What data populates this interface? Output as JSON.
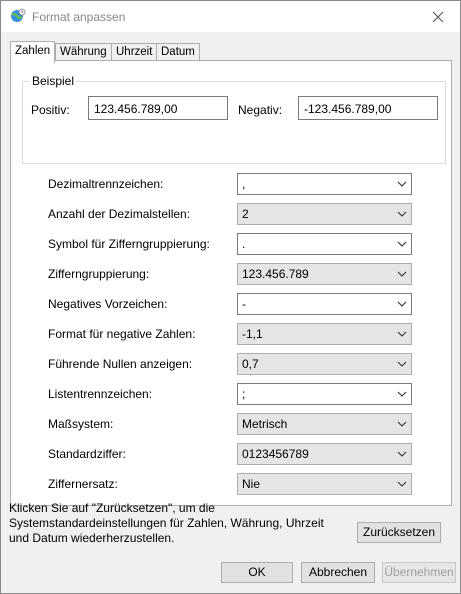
{
  "window": {
    "title": "Format anpassen"
  },
  "tabs": [
    {
      "label": "Zahlen",
      "active": true
    },
    {
      "label": "Währung",
      "active": false
    },
    {
      "label": "Uhrzeit",
      "active": false
    },
    {
      "label": "Datum",
      "active": false
    }
  ],
  "sample": {
    "group_title": "Beispiel",
    "positive_label": "Positiv:",
    "positive_value": "123.456.789,00",
    "negative_label": "Negativ:",
    "negative_value": "-123.456.789,00"
  },
  "settings": [
    {
      "label": "Dezimaltrennzeichen:",
      "value": ",",
      "readonly": false
    },
    {
      "label": "Anzahl der Dezimalstellen:",
      "value": "2",
      "readonly": true
    },
    {
      "label": "Symbol für Zifferngruppierung:",
      "value": ".",
      "readonly": false
    },
    {
      "label": "Zifferngruppierung:",
      "value": "123.456.789",
      "readonly": true
    },
    {
      "label": "Negatives Vorzeichen:",
      "value": "-",
      "readonly": false
    },
    {
      "label": "Format für negative Zahlen:",
      "value": "-1,1",
      "readonly": true
    },
    {
      "label": "Führende Nullen anzeigen:",
      "value": "0,7",
      "readonly": true
    },
    {
      "label": "Listentrennzeichen:",
      "value": ";",
      "readonly": false
    },
    {
      "label": "Maßsystem:",
      "value": "Metrisch",
      "readonly": true
    },
    {
      "label": "Standardziffer:",
      "value": "0123456789",
      "readonly": true
    },
    {
      "label": "Ziffernersatz:",
      "value": "Nie",
      "readonly": true
    }
  ],
  "info_text": "Klicken Sie auf \"Zurücksetzen\", um die Systemstandardeinstellungen für Zahlen, Währung, Uhrzeit und Datum wiederherzustellen.",
  "buttons": {
    "reset": "Zurücksetzen",
    "ok": "OK",
    "cancel": "Abbrechen",
    "apply": "Übernehmen"
  },
  "icons": {
    "app": "globe-clock-icon",
    "close": "close-icon",
    "dropdown": "chevron-down-icon"
  }
}
